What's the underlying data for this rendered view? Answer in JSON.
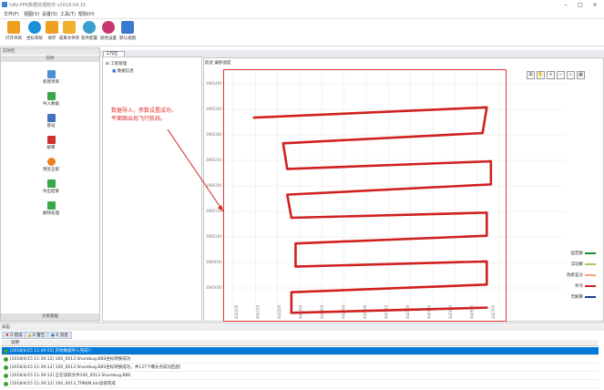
{
  "window": {
    "title": "UAV-PPK数据处理软件 v2018.04.15"
  },
  "menu": [
    {
      "label": "文件(F)"
    },
    {
      "label": "视图(V)"
    },
    {
      "label": "设置(S)"
    },
    {
      "label": "工具(T)"
    },
    {
      "label": "帮助(H)"
    }
  ],
  "toolbar": [
    {
      "label": "打开项目",
      "icon": "folder-icon",
      "color": "#f0a020"
    },
    {
      "label": "坐标系统",
      "icon": "globe-icon",
      "color": "#1a8fd8"
    },
    {
      "label": "保存",
      "icon": "save-icon",
      "color": "#f0a020"
    },
    {
      "label": "成果文件夹",
      "icon": "folder-icon",
      "color": "#f0b030"
    },
    {
      "label": "软件配置",
      "icon": "settings-icon",
      "color": "#3aa0d0"
    },
    {
      "label": "颜色设置",
      "icon": "palette-icon",
      "color": "#c83870"
    },
    {
      "label": "默认视图",
      "icon": "view-icon",
      "color": "#3a7ad0"
    }
  ],
  "leftpanel": {
    "title": "向导栏",
    "section": "向导",
    "footer": "大地基础",
    "items": [
      {
        "label": "新建项目",
        "icon": "new-doc-icon",
        "color": "#4a90d0"
      },
      {
        "label": "导入数据",
        "icon": "import-icon",
        "color": "#38a848"
      },
      {
        "label": "基站",
        "icon": "base-station-icon",
        "color": "#4070c0"
      },
      {
        "label": "解算",
        "icon": "solve-icon",
        "color": "#d03030"
      },
      {
        "label": "预览全部",
        "icon": "preview-icon",
        "color": "#f08020"
      },
      {
        "label": "导出结果",
        "icon": "export-icon",
        "color": "#38a848"
      },
      {
        "label": "删除处理",
        "icon": "delete-icon",
        "color": "#38a848"
      }
    ]
  },
  "tree": {
    "root": "工程管理",
    "child": "数据信息"
  },
  "document_tab": "工作区",
  "map": {
    "tabs": "航迹  偏移速度",
    "annotation_line1": "数据导入，参数设置成功，",
    "annotation_line2": "平面图出现飞行航线。",
    "y_ticks": [
      "3985400",
      "3985350",
      "3985300",
      "3985250",
      "3985200",
      "3985150",
      "3985100",
      "3985050",
      "3985000"
    ],
    "x_ticks": [
      "442100",
      "442150",
      "442200",
      "442250",
      "442300",
      "442350",
      "442400",
      "442450",
      "442500",
      "442550",
      "442600",
      "442650",
      "442700"
    ],
    "legend": [
      {
        "name": "固定解",
        "color": "#1f8c2f"
      },
      {
        "name": "浮动解",
        "color": "#9bcf5a"
      },
      {
        "name": "伪距差分",
        "color": "#f0a878"
      },
      {
        "name": "单点",
        "color": "#d02020"
      },
      {
        "name": "无解算",
        "color": "#1f3a8c"
      }
    ],
    "tool_icons": [
      "zoom-fit-icon",
      "pan-icon",
      "zoom-in-icon",
      "zoom-out-icon",
      "zoom-window-icon",
      "table-icon"
    ],
    "tool_glyphs": [
      "⊞",
      "✋",
      "+",
      "−",
      "⌕",
      "▦"
    ]
  },
  "chart_data": {
    "type": "line",
    "title": "",
    "xlabel": "",
    "ylabel": "",
    "xlim": [
      442080,
      442720
    ],
    "ylim": [
      3984980,
      3985420
    ],
    "series": [
      {
        "color": "#d02020",
        "x": [
          442130,
          442690,
          442680,
          442200,
          442210,
          442700,
          442700,
          442210,
          442220,
          442690,
          442690,
          442230,
          442230,
          442690,
          442690,
          442220,
          442220,
          442690
        ],
        "y": [
          3985340,
          3985360,
          3985310,
          3985290,
          3985240,
          3985255,
          3985210,
          3985190,
          3985145,
          3985155,
          3985110,
          3985095,
          3985050,
          3985060,
          3985015,
          3985000,
          3984960,
          3984970
        ]
      }
    ],
    "legend": [
      "固定解",
      "浮动解",
      "伪距差分",
      "单点",
      "无解算"
    ],
    "legend_position": "right",
    "grid": true
  },
  "log": {
    "title": "日志",
    "tabs": [
      {
        "label": "0 错误"
      },
      {
        "label": "0 警告"
      },
      {
        "label": "6 消息"
      }
    ],
    "column": "说明",
    "rows": [
      {
        "text": "[2018/4/15 11:49:55] 开始数据导入完成!!",
        "selected": true
      },
      {
        "text": "[2018/4/15 11:39:12] 100_0013 Sharebug.BBS坐标转换成功",
        "selected": false
      },
      {
        "text": "[2018/4/15 11:39:12] 100_0013 Sharebug.BBS坐标转换成功，共137个曝光点成功匹配!",
        "selected": false
      },
      {
        "text": "[2018/4/15 11:39:12] 正在读取文件100_0013 Sharebug.BBS",
        "selected": false
      },
      {
        "text": "[2018/4/15 11:39:12] 100_0013_TPB6M.bin读取完成",
        "selected": false
      }
    ]
  }
}
